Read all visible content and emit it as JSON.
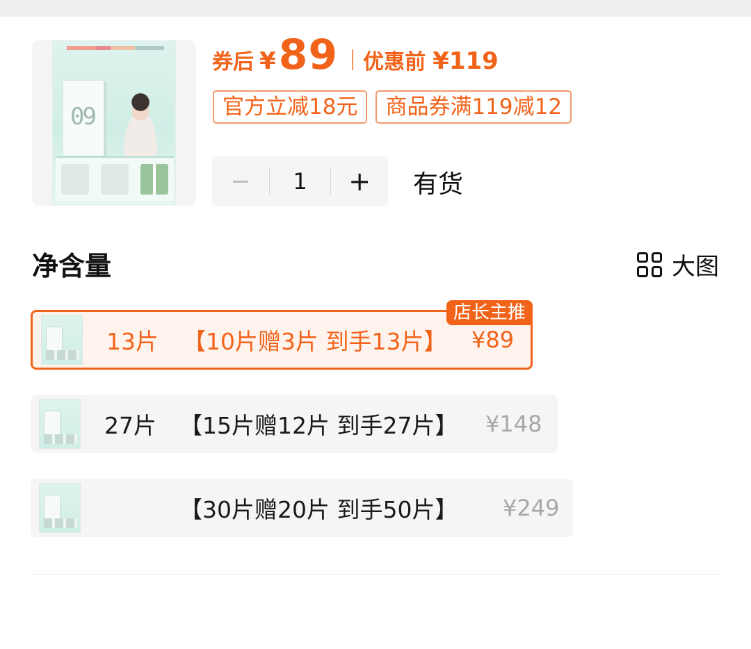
{
  "product": {
    "thumbnail_icon": "product-poster-image",
    "price_after_coupon_label": "券后",
    "price_after_coupon_currency": "¥",
    "price_after_coupon": "89",
    "price_before_label": "优惠前",
    "price_before": "¥119",
    "tags": [
      "官方立减18元",
      "商品券满119减12"
    ],
    "quantity": {
      "minus": "−",
      "value": "1",
      "plus": "+"
    },
    "stock_status": "有货"
  },
  "spec_section": {
    "title": "净含量",
    "big_view_label": "大图",
    "options": [
      {
        "count": "13片",
        "desc": "【10片赠3片 到手13片】",
        "price": "¥89",
        "badge": "店长主推",
        "selected": true
      },
      {
        "count": "27片",
        "desc": "【15片赠12片 到手27片】",
        "price": "¥148",
        "selected": false
      },
      {
        "count": "",
        "desc": "【30片赠20片 到手50片】",
        "price": "¥249",
        "selected": false
      }
    ]
  },
  "colors": {
    "accent": "#f2631a",
    "tag_border": "#f29b69",
    "selected_bg": "#fff3ee",
    "option_bg": "#f5f5f5",
    "muted_price": "#a8a8a8"
  }
}
